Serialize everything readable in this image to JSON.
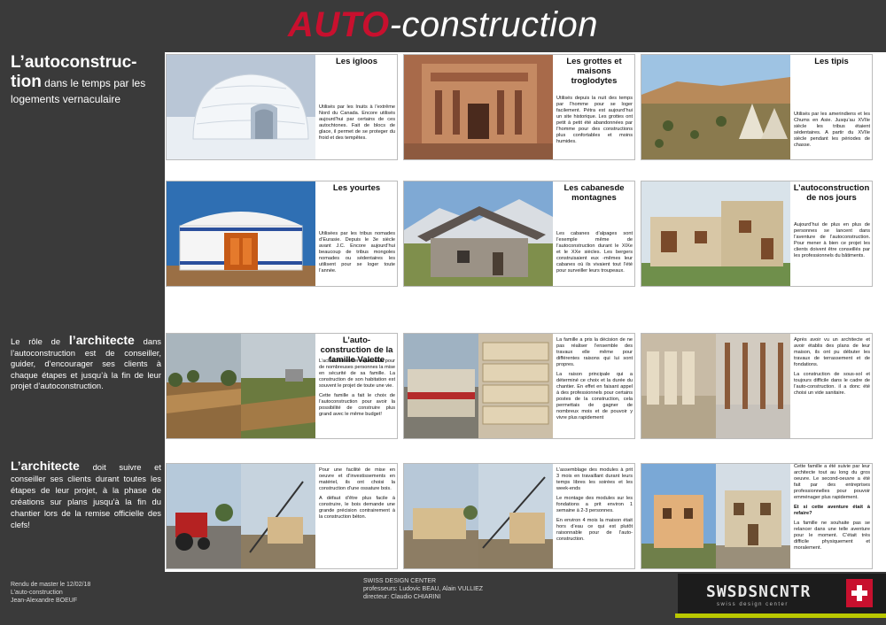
{
  "title": {
    "accent": "AUTO",
    "rest": "-construction"
  },
  "intro": {
    "big": "L’autoconstruc-tion",
    "rest": " dans le temps par les logements vernaculaire"
  },
  "role": {
    "pre": "Le rôle de ",
    "big": "l’architecte",
    "post": " dans l’autoconstruction est de conseiller, guider, d’encourager ses clients à chaque étapes et jusqu’à la fin de leur projet d’autoconstruction."
  },
  "suivre": {
    "big": "L’architecte",
    "post": " doit suivre et conseiller ses clients durant toutes les étapes de leur projet, à la phase de créations sur plans jusqu’à la fin du chantier lors de la remise officielle des clefs!"
  },
  "cells": {
    "igloos": {
      "title": "Les igloos",
      "body": "Utilisés par les Inuits à l’extrême Nord du Canada. Encore utilisés aujourd’hui par certains de ces autochtones. Fait de blocs de glace, il permet de se proteger du froid et des tempêtes."
    },
    "grottes": {
      "title": "Les grottes et maisons troglodytes",
      "body": "Utilisés depuis la nuit des temps par l’homme pour se loger facilement. Pétra est aujourd’hui un site historique. Les grottes ont petit à petit été abandonnées par l’homme pour des constructions plus confortables et moins humides."
    },
    "tipis": {
      "title": "Les tipis",
      "body": "Utilisés par les amerindiens et les Chums en Asie. Jusqu’au XVIIe siècle les tribus étaient sédentaires. A partir du XVIIe siècle pendant les périodes de chasse."
    },
    "yourtes": {
      "title": "Les yourtes",
      "body": "Utilisées par les tribus nomades d’Eurasie. Depuis le 3e siècle avant J.C. Encore aujourd’hui beaucoup de tribus mongoles nomades ou sédentaires les utilisent pour se loger toute l’année."
    },
    "cabanes": {
      "title": "Les cabanesde montagnes",
      "body": "Les cabanes d’alpages sont l’exemple même de l’autoconstruction durant le XIXe et le XXe siècles. Les bergers construisaient eux -mêmes leur cabanes où ils vivaient tout l’été pour surveiller leurs troupeaux."
    },
    "nosjours": {
      "title": "L’autoconstruction de nos jours",
      "body": "Aujourd’hui de plus en plus de personnes se lancent dans l’aventure de l’autoconstruction. Pour mener à bien ce projet les clients doivent être conseillés par les professionnels du bâtiments."
    },
    "valette": {
      "title": "L’auto-construction de la famille Valette",
      "p1": "L’achat immobilier représente pour de nombreuses personnes la mise en sécurité de sa famille. La construction de son habitation est souvent le projet de toute une vie.",
      "p2": "Cette famille a fait le choix de l’autoconstruction pour avoir la possibilité de construire plus grand avec le même budget!"
    },
    "decision": {
      "p1": "La famille a pris la décision de ne pas réaliser l’ensemble des travaux elle même pour différentes raisons qui lui sont propres.",
      "p2": "La raison principale qui a déterminé ce choix et la durée du chantier. En effet en faisant appel à des professionnels pour certains postes de la construction, cela permettais de gagner de nombreux mois et de pouvoir y vivre plus rapidement"
    },
    "travaux": {
      "p1": "Après avoir vu un architecte et avoir établis des plans de leur maison, ils ont pu débuter les travaux de terrassement et de fondations.",
      "p2": "La construction de sous-sol et toujours difficile dans le cadre de l’auto-construction. il a donc été choisi un vide sanitaire."
    },
    "ossature": {
      "p1": "Pour une facilité de mise en oeuvre et d’investissements en matériel, ils ont choisi la construction d’une ossature bois.",
      "p2": "A défaut d’être plus facile à construire, le bois demande une grande précision contrairement à la construction béton."
    },
    "modules": {
      "p1": "L’assemblage des modules à prit 3 mois en travaillant durant leurs temps libres les soirées et les week-ends",
      "p2": "Le montage des modules sur les fondations a prit environ 1 semaine à 2-3 personnes.",
      "p3": "En environ 4 mois la maison était hors d’eau ce qui est plutôt raisonnable pour de l’auto-construction."
    },
    "suivie": {
      "p1": "Cette famille a été suivie par leur architecte tout au long du gros oeuvre. Le second-oeuvre a été fait par des entreprises professionnelles pour pouvoir emménager plus rapidement.",
      "q": "Et si cette aventure était à refaire?",
      "p2": "La famille ne souhaite pas se relancer dans une telle aventure pour le moment. C’était très difficile physiquement et moralement."
    }
  },
  "footer": {
    "left1": "Rendu de master le 12/02/18",
    "left2": "L’auto-construction",
    "left3": "Jean-Alexandre BOEUF",
    "mid1": "SWISS DESIGN CENTER",
    "mid2": "professeurs: Ludovic BEAU, Alain VULLIEZ",
    "mid3": "directeur: Claudio CHIARINI"
  },
  "logo": {
    "text": "SWSDSNCNTR",
    "sub": "swiss design center"
  }
}
